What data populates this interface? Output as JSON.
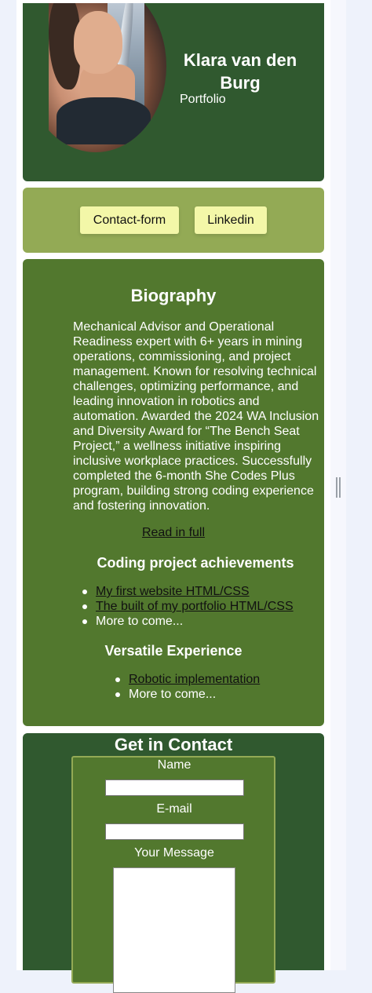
{
  "header": {
    "name": "Klara van den Burg",
    "subtitle": "Portfolio"
  },
  "buttons": {
    "contact_label": "Contact-form",
    "linkedin_label": "Linkedin"
  },
  "bio": {
    "heading": "Biography",
    "text": "Mechanical Advisor and Operational Readiness expert with 6+ years in mining operations, commissioning, and project management. Known for resolving technical challenges, optimizing performance, and leading innovation in robotics and automation. Awarded the 2024 WA Inclusion and Diversity Award for “The Bench Seat Project,” a wellness initiative inspiring inclusive workplace practices. Successfully completed the 6-month She Codes Plus program, building strong coding experience and fostering innovation.",
    "read_link": "Read in full",
    "coding_heading": "Coding project achievements",
    "coding_items": [
      "My first website HTML/CSS",
      "The built of my portfolio HTML/CSS",
      "More to come..."
    ],
    "versatile_heading": "Versatile Experience",
    "versatile_items": [
      "Robotic implementation",
      "More to come..."
    ]
  },
  "contact": {
    "heading": "Get in Contact",
    "name_label": "Name",
    "email_label": "E-mail",
    "message_label": "Your Message"
  }
}
